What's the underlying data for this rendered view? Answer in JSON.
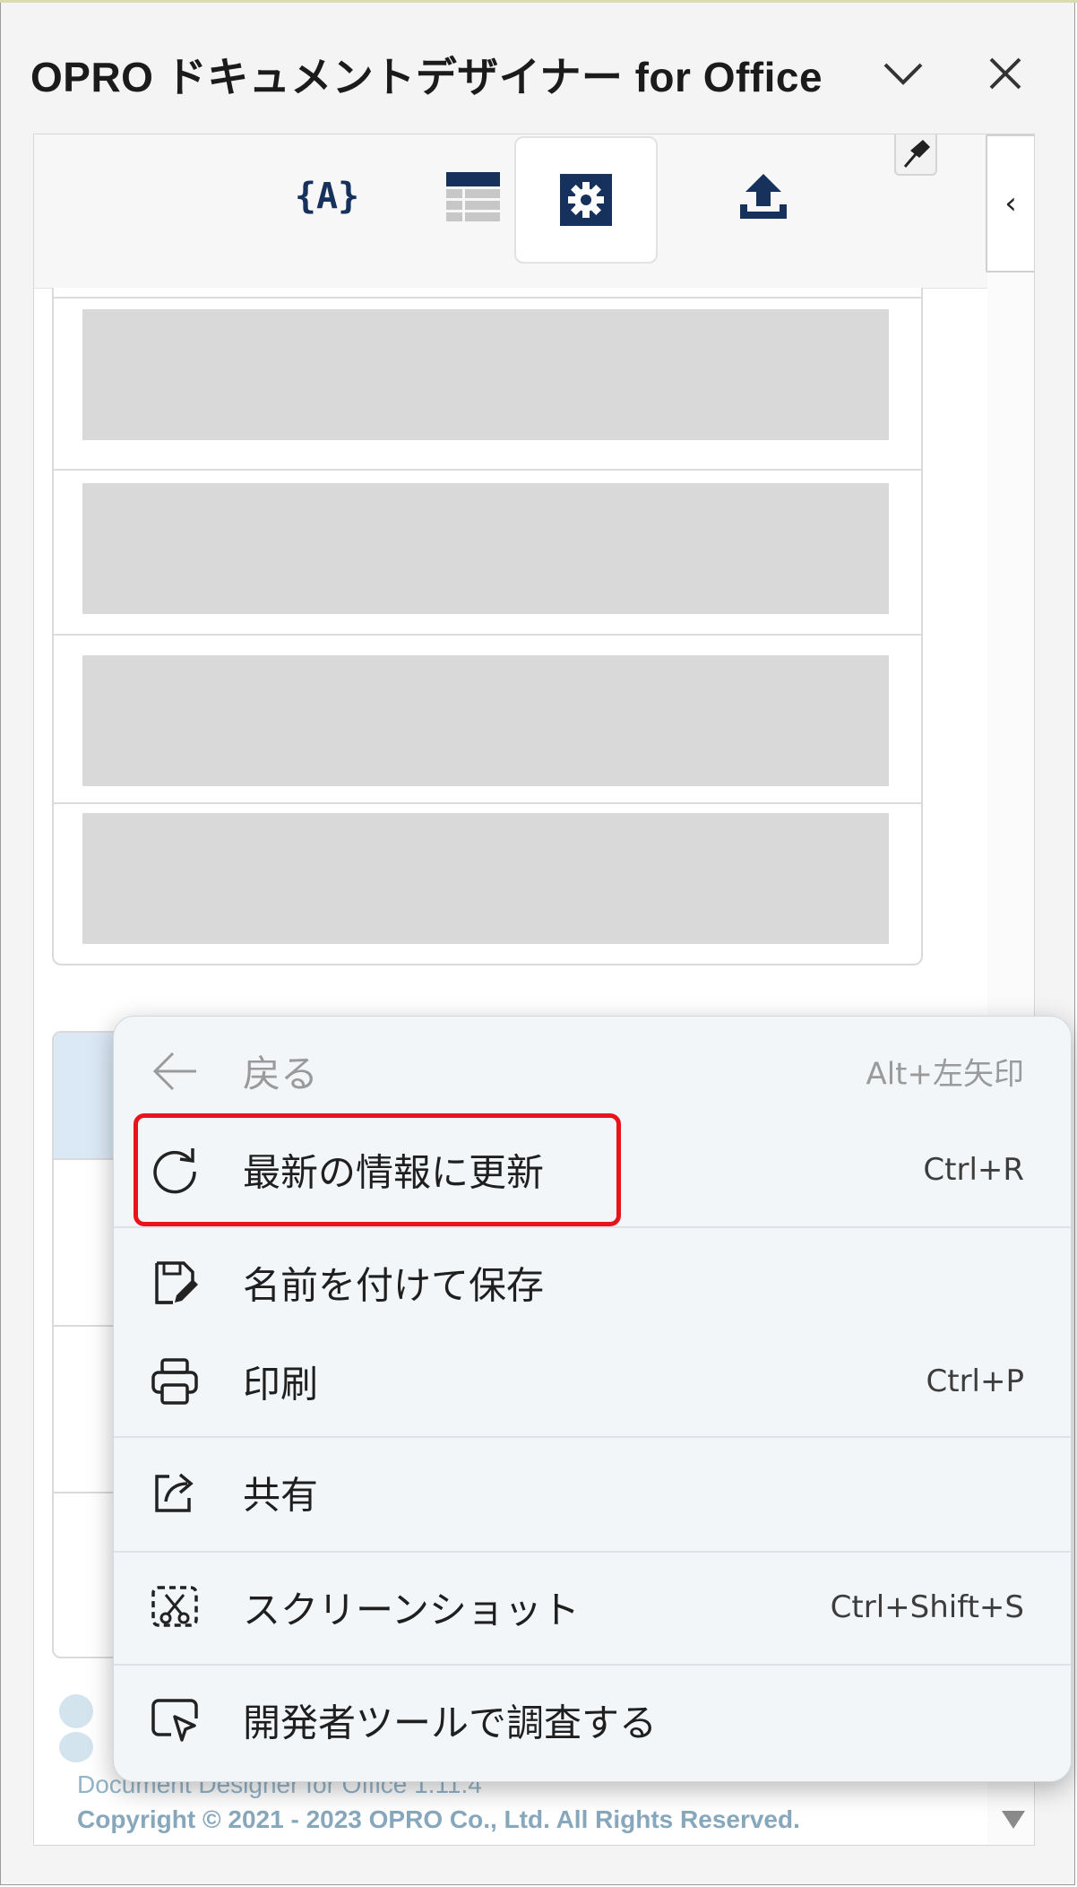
{
  "pane": {
    "title": "OPRO ドキュメントデザイナー for Office",
    "toolbar": {
      "buttons": [
        {
          "name": "variables",
          "icon": "braces-a-icon"
        },
        {
          "name": "table",
          "icon": "table-icon"
        },
        {
          "name": "settings",
          "icon": "gear-icon",
          "active": true
        },
        {
          "name": "upload",
          "icon": "upload-icon"
        }
      ]
    },
    "footer": {
      "version": "Document Designer for Office 1.11.4",
      "copyright": "Copyright © 2021 - 2023 OPRO Co., Ltd. All Rights Reserved."
    }
  },
  "context_menu": {
    "items": [
      {
        "label": "戻る",
        "shortcut": "Alt+左矢印",
        "icon": "back-arrow-icon",
        "disabled": true
      },
      {
        "label": "最新の情報に更新",
        "shortcut": "Ctrl+R",
        "icon": "refresh-icon",
        "highlighted": true
      },
      {
        "label": "名前を付けて保存",
        "shortcut": "",
        "icon": "save-as-icon"
      },
      {
        "label": "印刷",
        "shortcut": "Ctrl+P",
        "icon": "print-icon"
      },
      {
        "label": "共有",
        "shortcut": "",
        "icon": "share-icon"
      },
      {
        "label": "スクリーンショット",
        "shortcut": "Ctrl+Shift+S",
        "icon": "screenshot-icon"
      },
      {
        "label": "開発者ツールで調査する",
        "shortcut": "",
        "icon": "inspect-icon"
      }
    ]
  },
  "colors": {
    "accent_navy": "#16325c",
    "highlight_red": "#e8141c",
    "placeholder_gray": "#d9d9d9"
  }
}
